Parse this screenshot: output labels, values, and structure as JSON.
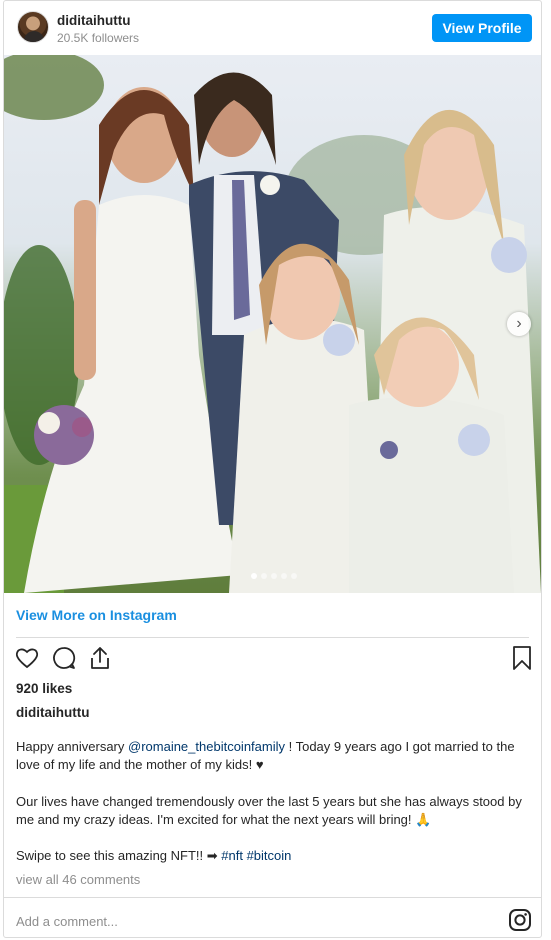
{
  "header": {
    "username": "diditaihuttu",
    "followers": "20.5K followers",
    "view_profile_label": "View Profile"
  },
  "post": {
    "carousel": {
      "slide_count": 5,
      "active_index": 0
    },
    "view_more_label": "View More on Instagram",
    "likes": "920 likes",
    "caption_user": "diditaihuttu",
    "caption": {
      "p1_before": "Happy anniversary ",
      "p1_mention": "@romaine_thebitcoinfamily",
      "p1_after": " ! Today 9 years ago I got married to the love of my life and the mother of my kids! ♥",
      "p2": "Our lives have changed tremendously over the last 5 years but she has always stood by me and my crazy ideas. I'm excited for what the next years will bring! 🙏",
      "p3_before": "Swipe to see this amazing NFT!! ➡ ",
      "p3_tag1": "#nft",
      "p3_space": " ",
      "p3_tag2": "#bitcoin"
    },
    "comments_link": "view all 46 comments",
    "comment_placeholder": "Add a comment..."
  },
  "icons": {
    "like": "heart-icon",
    "comment": "comment-icon",
    "share": "share-icon",
    "save": "bookmark-icon",
    "instagram": "instagram-icon",
    "next": "chevron-right-icon"
  },
  "colors": {
    "accent": "#0095f6",
    "link": "#00376b",
    "muted": "#8e8e8e",
    "text": "#262626",
    "border": "#dbdbdb"
  }
}
